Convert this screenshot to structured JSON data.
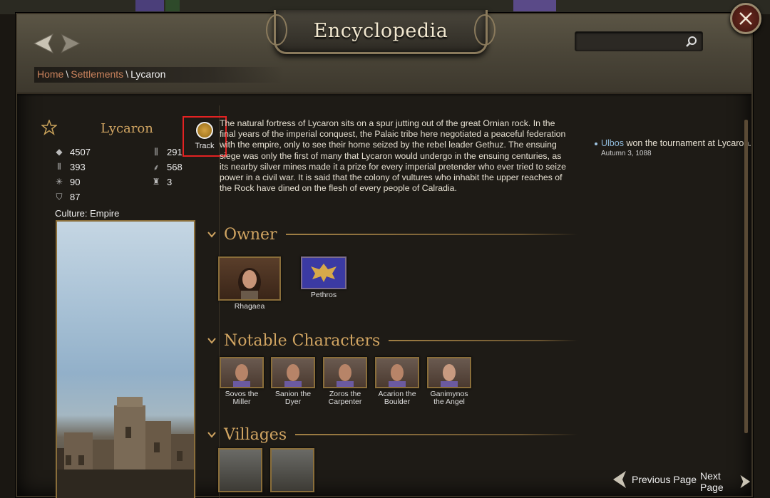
{
  "header": {
    "title": "Encyclopedia",
    "search_placeholder": ""
  },
  "breadcrumb": {
    "home": "Home",
    "separator": "\\",
    "section": "Settlements",
    "current": "Lycaron"
  },
  "settlement": {
    "name": "Lycaron",
    "track_label": "Track",
    "stats": {
      "prosperity": "4507",
      "militia": "393",
      "food": "90",
      "security": "87",
      "garrison": "291",
      "wall_strength": "568",
      "wall_level": "3"
    },
    "culture": "Culture: Empire"
  },
  "description": "The natural fortress of Lycaron sits on a spur jutting out of the great Ornian rock. In the final years of the imperial conquest, the Palaic tribe here negotiated a peaceful federation with the empire, only to see their home seized by the rebel leader Gethuz. The ensuing siege was only the first of many that Lycaron would undergo in the ensuing centuries, as its nearby silver mines made it a prize for every imperial pretender who ever tried to seize power in a civil war. It is said that the colony of vultures who inhabit the upper reaches of the Rock have dined on the flesh of every people of Calradia.",
  "sections": {
    "owner": "Owner",
    "notable": "Notable Characters",
    "villages": "Villages"
  },
  "owners": [
    {
      "name": "Rhagaea"
    },
    {
      "name": "Pethros"
    }
  ],
  "notables": [
    {
      "name": "Sovos the Miller"
    },
    {
      "name": "Sanion the Dyer"
    },
    {
      "name": "Zoros the Carpenter"
    },
    {
      "name": "Acarion the Boulder"
    },
    {
      "name": "Ganimynos the Angel"
    }
  ],
  "event": {
    "actor": "Ulbos",
    "text": " won the tournament at Lycaron.",
    "date": "Autumn 3, 1088"
  },
  "pagination": {
    "previous": "Previous Page",
    "next": "Next Page"
  },
  "colors": {
    "accent_gold": "#d1a562",
    "link_orange": "#c9825c",
    "link_blue": "#8eb8d8",
    "highlight_red": "#e32222"
  }
}
